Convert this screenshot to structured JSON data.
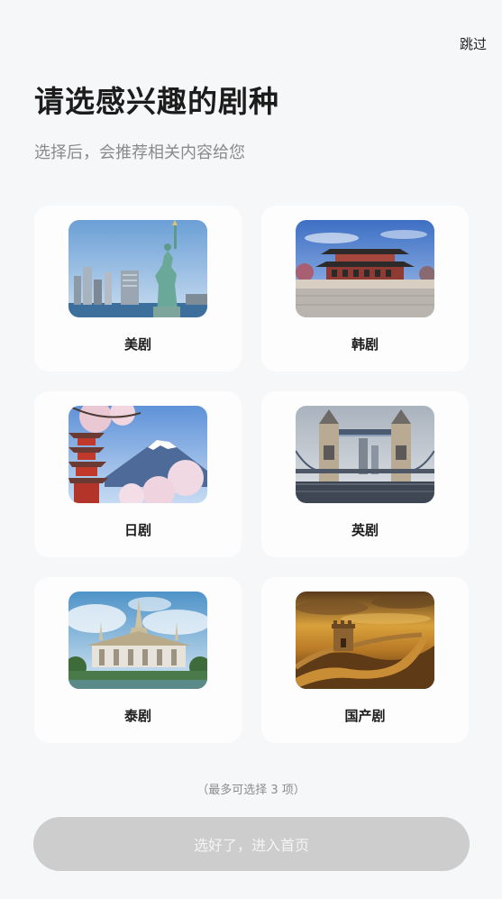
{
  "header": {
    "skip_label": "跳过",
    "title": "请选感兴趣的剧种",
    "subtitle": "选择后，会推荐相关内容给您"
  },
  "genres": [
    {
      "label": "美剧",
      "image": "statue-of-liberty-nyc-image"
    },
    {
      "label": "韩剧",
      "image": "gyeongbokgung-palace-image"
    },
    {
      "label": "日剧",
      "image": "mount-fuji-pagoda-image"
    },
    {
      "label": "英剧",
      "image": "tower-bridge-image"
    },
    {
      "label": "泰剧",
      "image": "thai-temple-image"
    },
    {
      "label": "国产剧",
      "image": "great-wall-image"
    }
  ],
  "footer": {
    "limit_hint": "（最多可选择 3 项）",
    "confirm_label": "选好了，进入首页"
  },
  "colors": {
    "background": "#f6f7f9",
    "card": "#fdfdfd",
    "button_disabled": "#cdcdcd"
  }
}
